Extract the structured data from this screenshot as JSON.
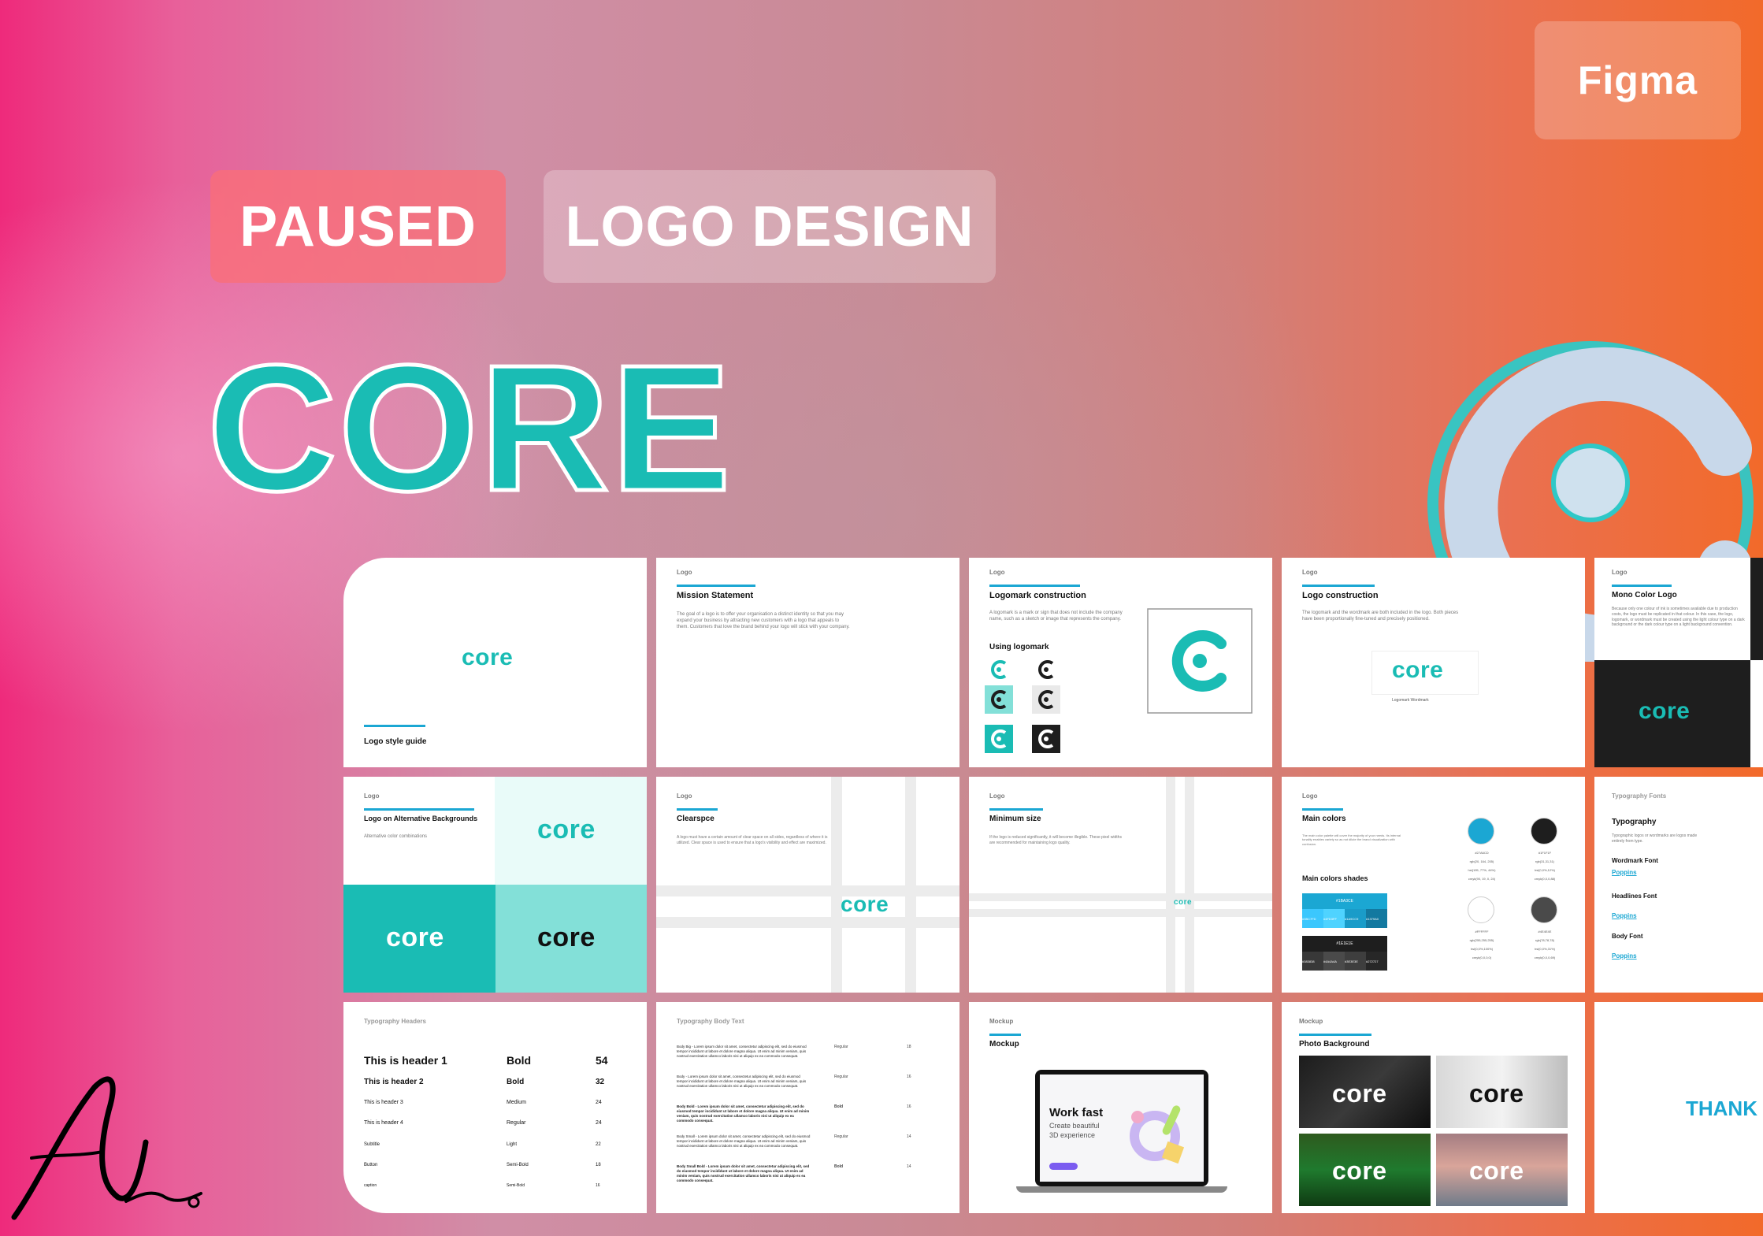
{
  "badges": {
    "tool": "Figma",
    "status": "PAUSED",
    "category": "LOGO DESIGN"
  },
  "hero": {
    "title": "CORE"
  },
  "brand": {
    "wordmark": "core",
    "accent": "#1abcb4",
    "blue": "#1ba7d3",
    "dark": "#1e1e1e"
  },
  "slides": {
    "cover": {
      "wordmark": "core",
      "caption": "Logo style guide"
    },
    "mission": {
      "tag": "Logo",
      "title": "Mission Statement",
      "body": "The goal of a logo is to offer your organisation a distinct identity so that you may expand your business by attracting new customers with a logo that appeals to them. Customers that love the brand behind your logo will stick with your company."
    },
    "logomark": {
      "tag": "Logo",
      "title": "Logomark construction",
      "body": "A logomark is a mark or sign that does not include the company name, such as a sketch or image that represents the company.",
      "using": "Using logomark"
    },
    "construction": {
      "tag": "Logo",
      "title": "Logo construction",
      "body": "The logomark and the wordmark are both included in the logo. Both pieces have been proportionally fine-tuned and precisely positioned.",
      "wordmark": "core",
      "labels": "Logomark   Wordmark"
    },
    "mono": {
      "tag": "Logo",
      "title": "Mono Color Logo",
      "body": "Because only one colour of ink is sometimes available due to production costs, the logo must be replicated in that colour. In this case, the logo, logomark, or wordmark must be created using the light colour type on a dark background or the dark colour type on a light background convention.",
      "wordmark": "core"
    },
    "alt": {
      "tag": "Logo",
      "title": "Logo on Alternative Backgrounds",
      "body": "Alternative color combinations",
      "wordmarks": [
        "core",
        "core",
        "core"
      ]
    },
    "clearspace": {
      "tag": "Logo",
      "title": "Clearspce",
      "body": "A logo must have a certain amount of clear space on all sides, regardless of where it is utilized. Clear space is used to ensure that a logo's visibility and effect are maximized.",
      "wordmark": "core"
    },
    "minsize": {
      "tag": "Logo",
      "title": "Minimum size",
      "body": "If the logo is reduced significantly, it will become illegible. These pixel widths are recommended for maintaining logo quality.",
      "wordmark": "core"
    },
    "colors": {
      "tag": "Logo",
      "title": "Main colors",
      "shades_title": "Main colors shades",
      "body": "The main color palette will cover the majority of your needs. Its internal tonality enables variety so as not dilute the brand visualization with confusion.",
      "swatches": [
        {
          "hex": "#1BA3CE",
          "color": "#1ba7d3",
          "lines": [
            "#27A6CD",
            "rgb(20, 164, 205)",
            "hsl(195, 77%, 44%)",
            "cmyk(90, 19, 0, 24)"
          ]
        },
        {
          "hex": "#1E1E1E",
          "color": "#1e1e1e",
          "lines": [
            "#1F1F1F",
            "rgb(31,31,31)",
            "hsl(0,0%,12%)",
            "cmyk(0,0,0,88)"
          ]
        },
        {
          "hex": "#FFFFFF",
          "color": "#ffffff",
          "lines": [
            "#FFFFFF",
            "rgb(255,255,255)",
            "hsl(0,0%,100%)",
            "cmyk(0,0,0,0)"
          ]
        },
        {
          "hex": "#4A4A4A",
          "color": "#4a4a4a",
          "lines": [
            "#4E4E4E",
            "rgb(78,78,78)",
            "hsl(0,0%,31%)",
            "cmyk(0,0,0,69)"
          ]
        }
      ],
      "shade_codes_blue": [
        "#1BA3CE",
        "#3BC7FD",
        "#4FD3FF",
        "#1A9CC9",
        "#1379A0"
      ],
      "shade_codes_dark": [
        "#1E1E1E",
        "#383838",
        "#4A4A4A",
        "#3E3E3E",
        "#272727"
      ]
    },
    "typography": {
      "tag": "Typography Fonts",
      "title": "Typography",
      "body": "Typographic logos or wordmarks are logos made entirely from type.",
      "items": [
        {
          "label": "Wordmark Font",
          "font": "Poppins"
        },
        {
          "label": "Headlines Font",
          "font": "Poppins"
        },
        {
          "label": "Body Font",
          "font": "Poppins"
        }
      ]
    },
    "headers": {
      "tag": "Typography Headers",
      "rows": [
        {
          "name": "This is header 1",
          "weight": "Bold",
          "size": "54"
        },
        {
          "name": "This is header 2",
          "weight": "Bold",
          "size": "32"
        },
        {
          "name": "This is header 3",
          "weight": "Medium",
          "size": "24"
        },
        {
          "name": "This is header 4",
          "weight": "Regular",
          "size": "24"
        },
        {
          "name": "Subtitle",
          "weight": "Light",
          "size": "22"
        },
        {
          "name": "Button",
          "weight": "Semi-Bold",
          "size": "18"
        },
        {
          "name": "caption",
          "weight": "Semi-Bold",
          "size": "16"
        }
      ]
    },
    "bodytext": {
      "tag": "Typography Body Text",
      "rows": [
        {
          "text": "Body Big - Lorem ipsum dolor sit amet, consectetur adipiscing elit, sed do eiusmod tempor incididunt ut labore et dolore magna aliqua. Ut enim ad minim veniam, quis nostrud exercitation ullamco laboris nisi ut aliquip ex ea commodo consequat.",
          "weight": "Regular",
          "size": "18"
        },
        {
          "text": "Body - Lorem ipsum dolor sit amet, consectetur adipiscing elit, sed do eiusmod tempor incididunt ut labore et dolore magna aliqua. Ut enim ad minim veniam, quis nostrud exercitation ullamco laboris nisi ut aliquip ex ea commodo consequat.",
          "weight": "Regular",
          "size": "16"
        },
        {
          "text": "Body Bold - Lorem ipsum dolor sit amet, consectetur adipiscing elit, sed do eiusmod tempor incididunt ut labore et dolore magna aliqua. Ut enim ad minim veniam, quis nostrud exercitation ullamco laboris nisi ut aliquip ex ea commodo consequat.",
          "weight": "Bold",
          "size": "16"
        },
        {
          "text": "Body Small - Lorem ipsum dolor sit amet, consectetur adipiscing elit, sed do eiusmod tempor incididunt ut labore et dolore magna aliqua. Ut enim ad minim veniam, quis nostrud exercitation ullamco laboris nisi ut aliquip ex ea commodo consequat.",
          "weight": "Regular",
          "size": "14"
        },
        {
          "text": "Body Small Bold - Lorem ipsum dolor sit amet, consectetur adipiscing elit, sed do eiusmod tempor incididunt ut labore et dolore magna aliqua. Ut enim ad minim veniam, quis nostrud exercitation ullamco laboris nisi ut aliquip ex ea commodo consequat.",
          "weight": "Bold",
          "size": "14"
        }
      ]
    },
    "mockup": {
      "tag": "Mockup",
      "title": "Mockup",
      "headline": "Work fast",
      "sub1": "Create beautiful",
      "sub2": "3D experience"
    },
    "photos": {
      "tag": "Mockup",
      "title": "Photo Background",
      "wordmarks": [
        "core",
        "core",
        "core",
        "core"
      ]
    },
    "thanks": {
      "text": "THANK"
    }
  }
}
